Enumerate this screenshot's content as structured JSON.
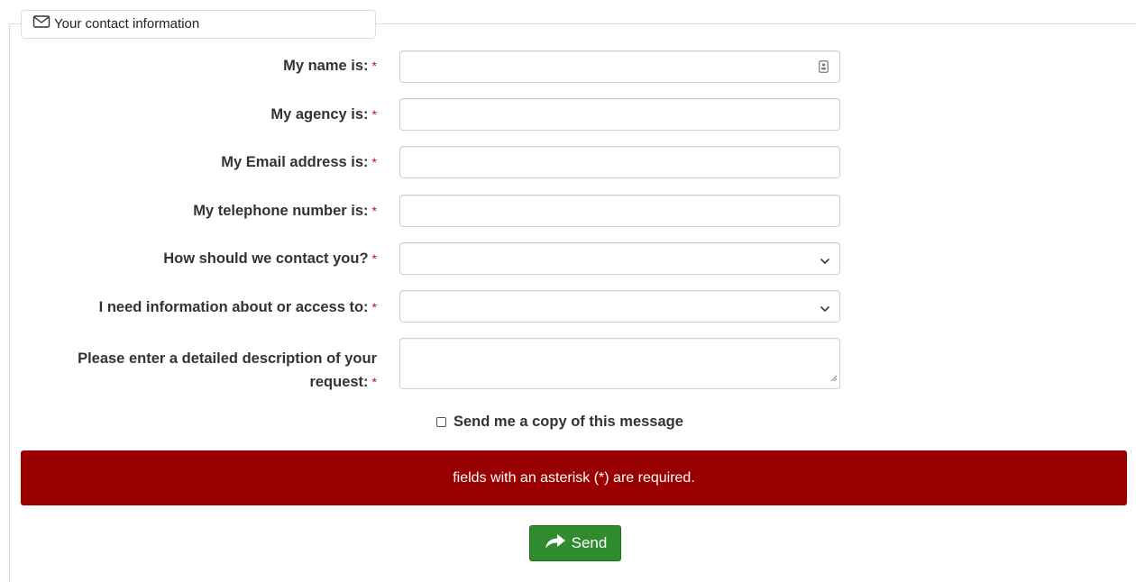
{
  "legend": {
    "icon": "envelope-icon",
    "title": "Your contact information"
  },
  "required_marker": "*",
  "fields": [
    {
      "label": "My name is:",
      "type": "text",
      "value": "",
      "icon": "autofill-contact-icon"
    },
    {
      "label": "My agency is:",
      "type": "text",
      "value": ""
    },
    {
      "label": "My Email address is:",
      "type": "text",
      "value": ""
    },
    {
      "label": "My telephone number is:",
      "type": "text",
      "value": ""
    },
    {
      "label": "How should we contact you?",
      "type": "select",
      "value": "",
      "icon": "chevron-down-icon"
    },
    {
      "label": "I need information about or access to:",
      "type": "select",
      "value": "",
      "icon": "chevron-down-icon"
    },
    {
      "label_line1": "Please enter a detailed description of your",
      "label_line2": "request:",
      "type": "textarea",
      "value": ""
    }
  ],
  "copy_checkbox": {
    "label": "Send me a copy of this message",
    "checked": false
  },
  "alert": {
    "text": "fields with an asterisk (*) are required.",
    "color": "#990000"
  },
  "send_button": {
    "label": "Send",
    "icon": "share-arrow-icon",
    "color": "#2e8b2e"
  }
}
